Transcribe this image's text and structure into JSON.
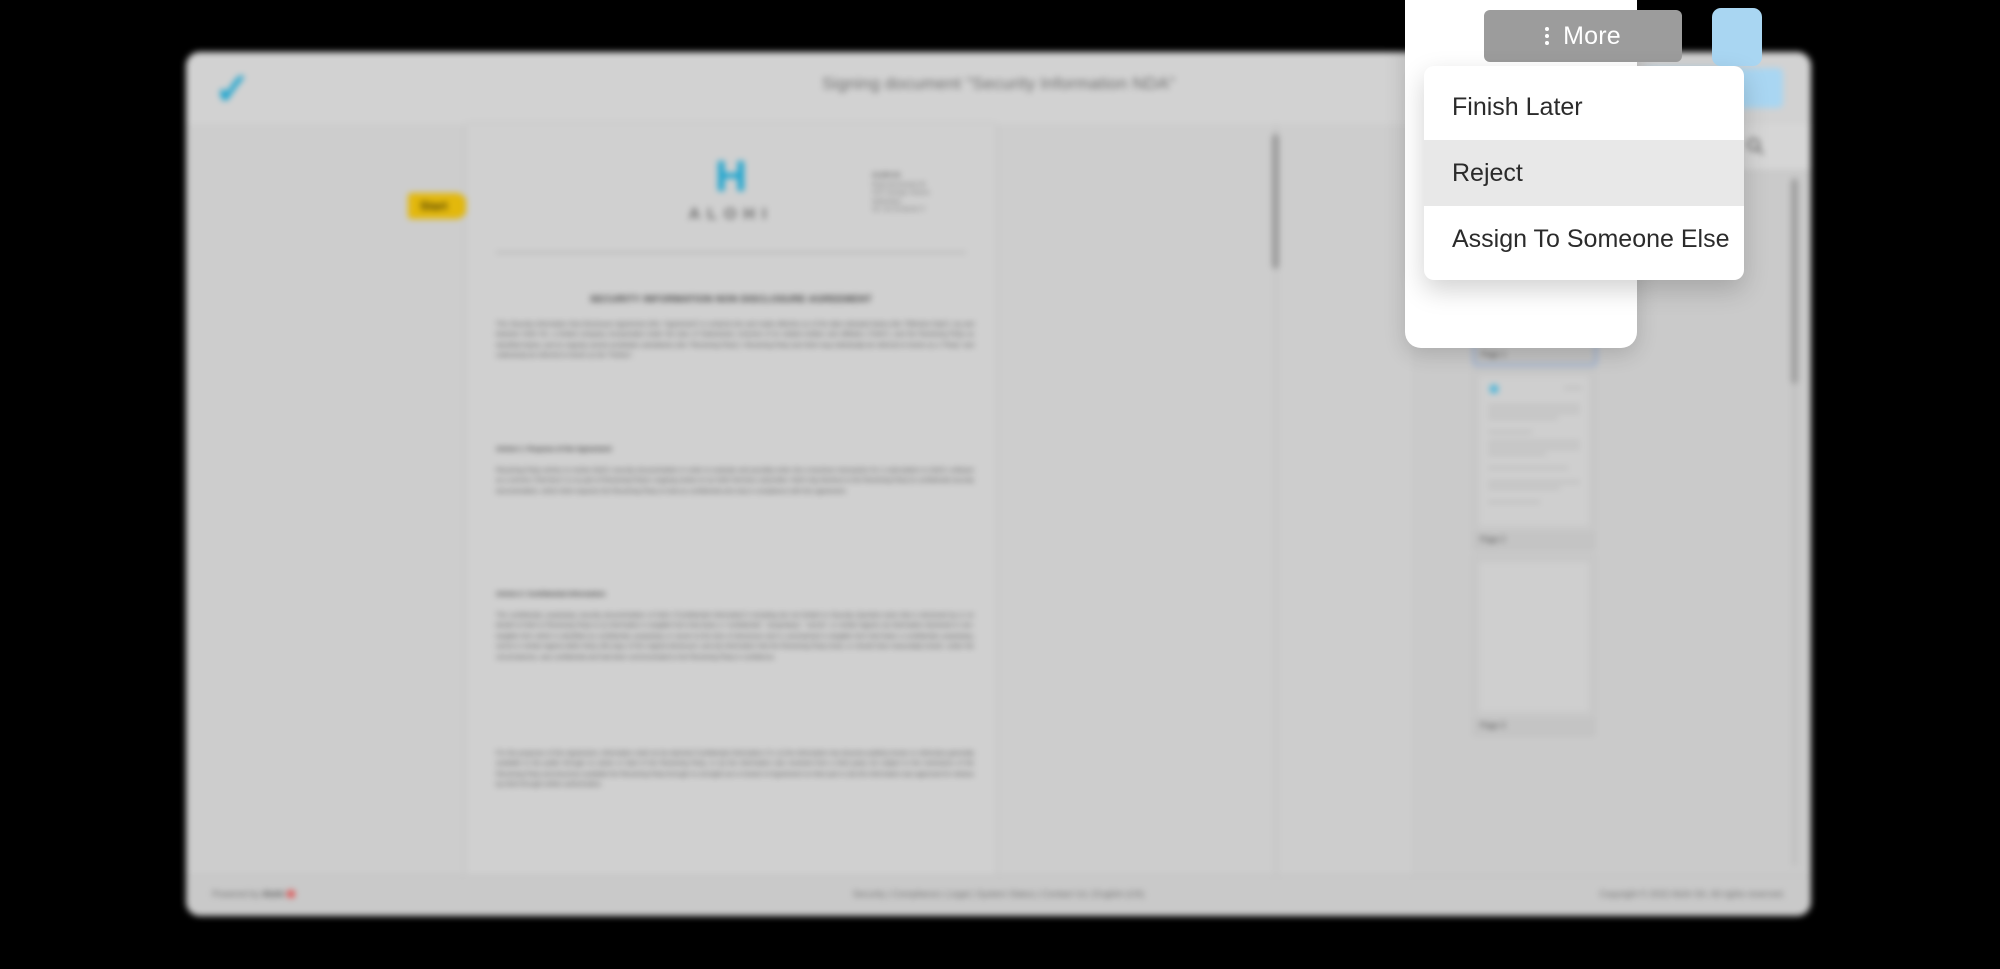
{
  "app": {
    "logo_icon": "blue-check-logo",
    "header_title": "Signing document \"Security Information NDA\""
  },
  "toolbar": {
    "more_label": "More",
    "more_icon": "vertical-dots-icon",
    "search_icon": "magnifier-icon"
  },
  "dropdown": {
    "items": [
      {
        "label": "Finish Later",
        "hovered": false
      },
      {
        "label": "Reject",
        "hovered": true
      },
      {
        "label": "Assign To Someone Else",
        "hovered": false
      }
    ]
  },
  "document": {
    "start_tag": "Start",
    "logo_letter": "H",
    "logo_name": "ALOHI",
    "address_company": "ALOHI SA",
    "address_lines": "Route des Acacias 45\n1227 Carouge, Geneva\nSwitzerland\nTel: +41 22 518 05 77",
    "title": "SECURITY INFORMATION NON DISCLOSURE AGREEMENT",
    "paragraph_1": "This Security Information Non-Disclosure Agreement (this \"Agreement\") is entered into and made effective as of the date indicated below (the \"Effective Date\"), by and between Alohi SA, a limited company incorporated under the laws of Switzerland, inclusive of its related entities and affiliates (\"Alohi\"), and the Receiving Party as identified below, and its majority owned worldwide subsidiaries (the \"Receiving Party\"). Receiving Party and Alohi may individually be referred to herein as a \"Party\" and collectively be referred to herein as the \"Parties\".",
    "heading_1": "Article 1: Purpose of the Agreement",
    "paragraph_2": "Receiving Party wishes to review Alohi's security documentation in order to evaluate and possibly enter into a business transaction for a subscription to Alohi's software as a service (\"Services\") or as part of Receiving Party's ongoing review on an Alohi Services subscriber. Alohi may disclose to the Receiving Party its confidential security documentation, which Alohi requests the Receiving Party to treat as confidential and only in compliance with this agreement.",
    "heading_2": "Article 2: Confidential Information",
    "paragraph_3": "The confidential, proprietary security documentation of Alohi (\"Confidential Information\") including but not limited to Security Question tests that is disclosed by or on behalf of Alohi to Receiving Party to (i) information is tangible form that bears a \"confidential\", \"proprietary\", \"secret\", or similar legend; (ii) information disclosed in non-tangible form which is identified as confidential, proprietary or secret at the time of disclosure and is summarized in tangible form that bears a confidential, proprietary, secret or similar legend within thirty (30) days of the original disclosure; and (iii) information that the Receiving Party knew, or should have reasonably known, under the circumstances, was confidential and had been communicated to the Receiving Party in confidence.",
    "paragraph_4": "For the purposes of this Agreement, information shall not be deemed Confidential Information if it: (i) the information has become publicly known or otherwise generally available to the public through no action or fault of the Receiving Party, or (ii) the information was received from a third party not subject to the restrictions of the Receiving Party and becomes available the Receiving Party through no wrongful act or breach of Agreement on their part or (iii) the information was approved for release by Alohi through written authorization."
  },
  "thumbnails": {
    "pages": [
      {
        "label": "Page 1",
        "selected": true
      },
      {
        "label": "Page 2",
        "selected": false
      },
      {
        "label": "Page 3",
        "selected": false
      }
    ]
  },
  "footer": {
    "powered_by_prefix": "Powered by ",
    "powered_by_brand": "Alohi",
    "links": "Security  |  Compliance  |  Legal  |  System Status  |  Contact Us  |  English (US)",
    "copyright": "Copyright © 2022 Alohi SA. All rights reserved."
  }
}
